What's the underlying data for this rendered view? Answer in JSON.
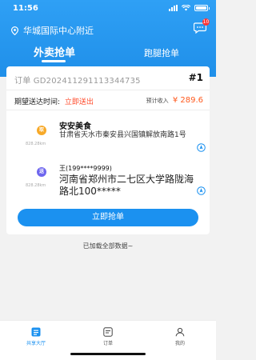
{
  "status_bar": {
    "time": "11:56"
  },
  "header": {
    "location": "华城国际中心附近",
    "message_badge": "10"
  },
  "tabs": [
    {
      "label": "外卖抢单",
      "active": true
    },
    {
      "label": "跑腿抢单",
      "active": false
    }
  ],
  "order": {
    "order_number": "订单 GD202411291113344735",
    "index": "#1",
    "expected_label": "期望送达时间:",
    "expected_value": "立即送出",
    "income_label": "预计收入",
    "income_value": "¥ 289.6",
    "pickup": {
      "badge": "取",
      "distance": "828.28km",
      "title": "安安美食",
      "address": "甘肃省天水市秦安县兴国镇解放南路1号"
    },
    "dropoff": {
      "badge": "送",
      "distance": "828.28km",
      "title": "王(199****9999)",
      "address": "河南省郑州市二七区大学路陇海路北100*****"
    },
    "grab_button": "立即抢单"
  },
  "footer_text": "已加载全部数据~",
  "tabbar": [
    {
      "label": "共享大厅",
      "icon": "hall-icon",
      "active": true
    },
    {
      "label": "订单",
      "icon": "order-icon",
      "active": false
    },
    {
      "label": "我的",
      "icon": "profile-icon",
      "active": false
    }
  ],
  "colors": {
    "brand": "#1b91f0",
    "header": "#2fa0f5",
    "alert": "#ff4a2a",
    "pickup_badge": "#f7a928",
    "dropoff_badge": "#6e66ee"
  }
}
